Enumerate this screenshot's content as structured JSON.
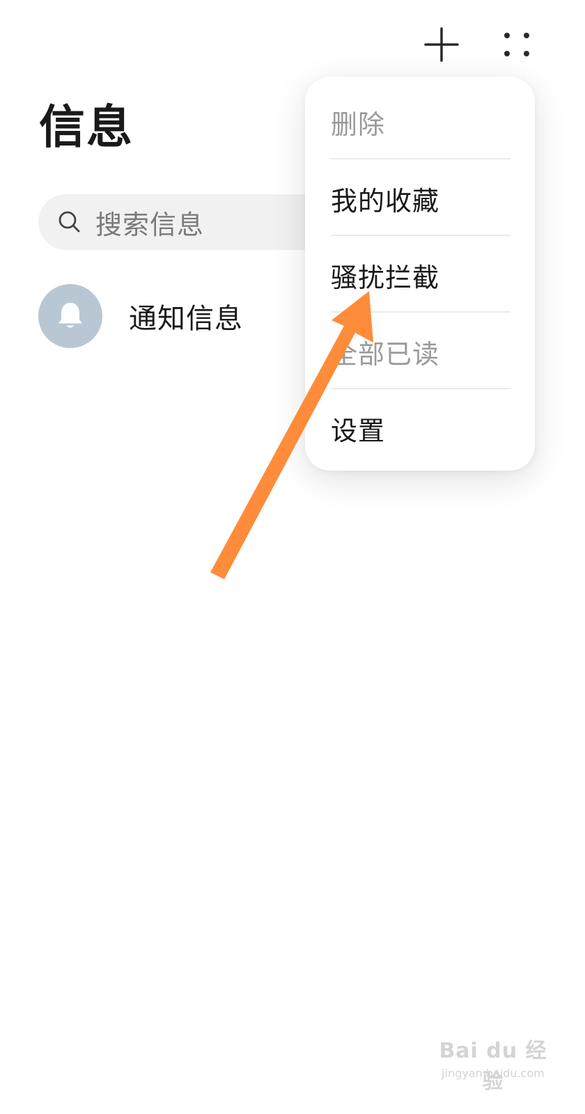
{
  "header": {
    "title": "信息",
    "icons": [
      "plus-icon",
      "more-options-icon"
    ]
  },
  "search": {
    "placeholder": "搜索信息"
  },
  "conversations": [
    {
      "label": "通知信息",
      "icon": "bell-icon",
      "avatar_color": "#b9c7d5"
    }
  ],
  "menu": {
    "items": [
      {
        "label": "删除",
        "enabled": false
      },
      {
        "label": "我的收藏",
        "enabled": true
      },
      {
        "label": "骚扰拦截",
        "enabled": true
      },
      {
        "label": "全部已读",
        "enabled": false
      },
      {
        "label": "设置",
        "enabled": true
      }
    ]
  },
  "annotation": {
    "arrow_color": "#ff8c3a",
    "points_to": "骚扰拦截"
  },
  "watermark": {
    "brand": "Bai du 经验",
    "url": "jingyan.baidu.com"
  }
}
